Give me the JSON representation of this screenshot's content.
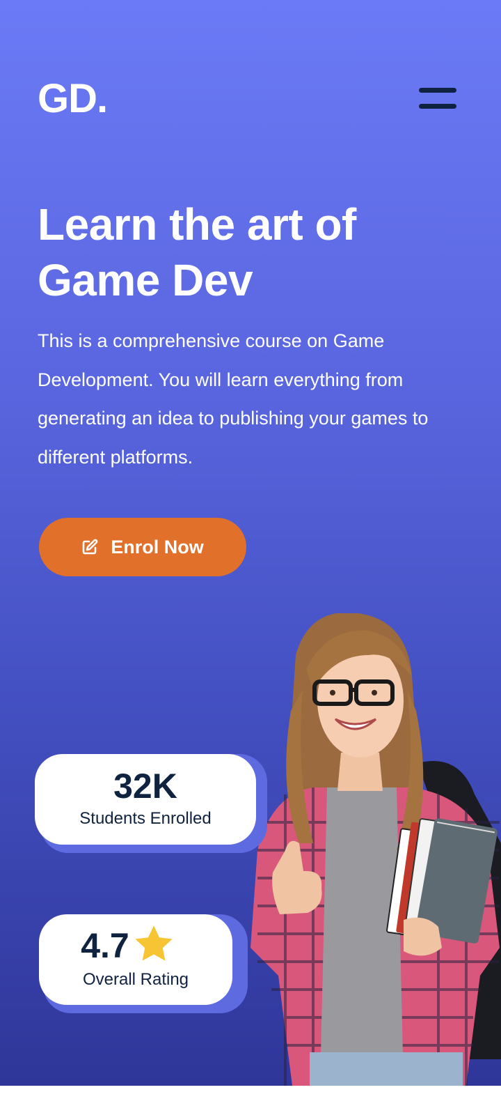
{
  "brand": {
    "logo_text": "GD."
  },
  "nav": {
    "menu_icon": "hamburger-menu-icon"
  },
  "hero": {
    "headline_line1": "Learn the art of",
    "headline_line2": "Game Dev",
    "description": "This is a comprehensive course on Game Development. You will learn everything from generating an idea to publishing your games to different platforms.",
    "cta_label": "Enrol Now",
    "cta_icon": "edit-icon"
  },
  "stats": {
    "students": {
      "value": "32K",
      "label": "Students Enrolled"
    },
    "rating": {
      "value": "4.7",
      "label": "Overall Rating",
      "icon": "star-icon"
    }
  },
  "colors": {
    "gradient_top": "#6b7af6",
    "gradient_bottom": "#2f3699",
    "accent": "#e0702a",
    "text_dark": "#0f2340",
    "star": "#f7c533"
  }
}
